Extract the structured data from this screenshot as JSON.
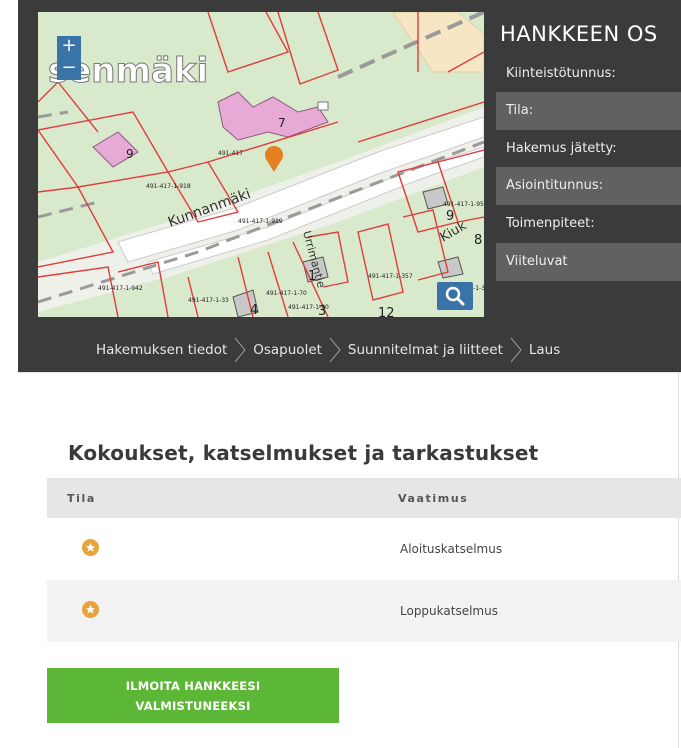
{
  "map": {
    "zoom_in_label": "+",
    "zoom_out_label": "−",
    "place_name": "senmäki",
    "street_name_1": "Kunnanmäki",
    "street_name_2": "Urrimantie",
    "street_name_3": "Kiuk",
    "lot_numbers": [
      "9",
      "7",
      "9",
      "8",
      "1",
      "4",
      "3",
      "12"
    ],
    "parcel_ids": [
      "491-417",
      "491-417-1-918",
      "491-417-1-919",
      "491-417-1-956",
      "491-417-1-357",
      "491-417-1-942",
      "491-417-1-33",
      "491-417-1-70",
      "491-417-1-90",
      "491-417-1-357"
    ],
    "marker_color": "#e67e22"
  },
  "panel": {
    "title": "HANKKEEN OS",
    "fields": [
      {
        "label": "Kiinteistötunnus:"
      },
      {
        "label": "Tila:"
      },
      {
        "label": "Hakemus jätetty:"
      },
      {
        "label": "Asiointitunnus:"
      },
      {
        "label": "Toimenpiteet:"
      },
      {
        "label": "Viiteluvat"
      }
    ]
  },
  "breadcrumb": {
    "items": [
      {
        "label": "Hakemuksen tiedot"
      },
      {
        "label": "Osapuolet"
      },
      {
        "label": "Suunnitelmat ja liitteet"
      },
      {
        "label": "Laus"
      }
    ]
  },
  "section": {
    "title": "Kokoukset, katselmukset ja tarkastukset",
    "columns": {
      "tila": "Tila",
      "vaatimus": "Vaatimus"
    },
    "rows": [
      {
        "status_icon": "star-icon",
        "vaatimus": "Aloituskatselmus"
      },
      {
        "status_icon": "star-icon",
        "vaatimus": "Loppukatselmus"
      }
    ]
  },
  "cta": {
    "line1": "ILMOITA HANKKEESI",
    "line2": "VALMISTUNEEKSI"
  },
  "colors": {
    "header_bg": "#3b3b3b",
    "field_shaded": "#616161",
    "cta_green": "#5db736",
    "star_orange": "#e8a33b",
    "map_button_blue": "#3a73a8"
  }
}
